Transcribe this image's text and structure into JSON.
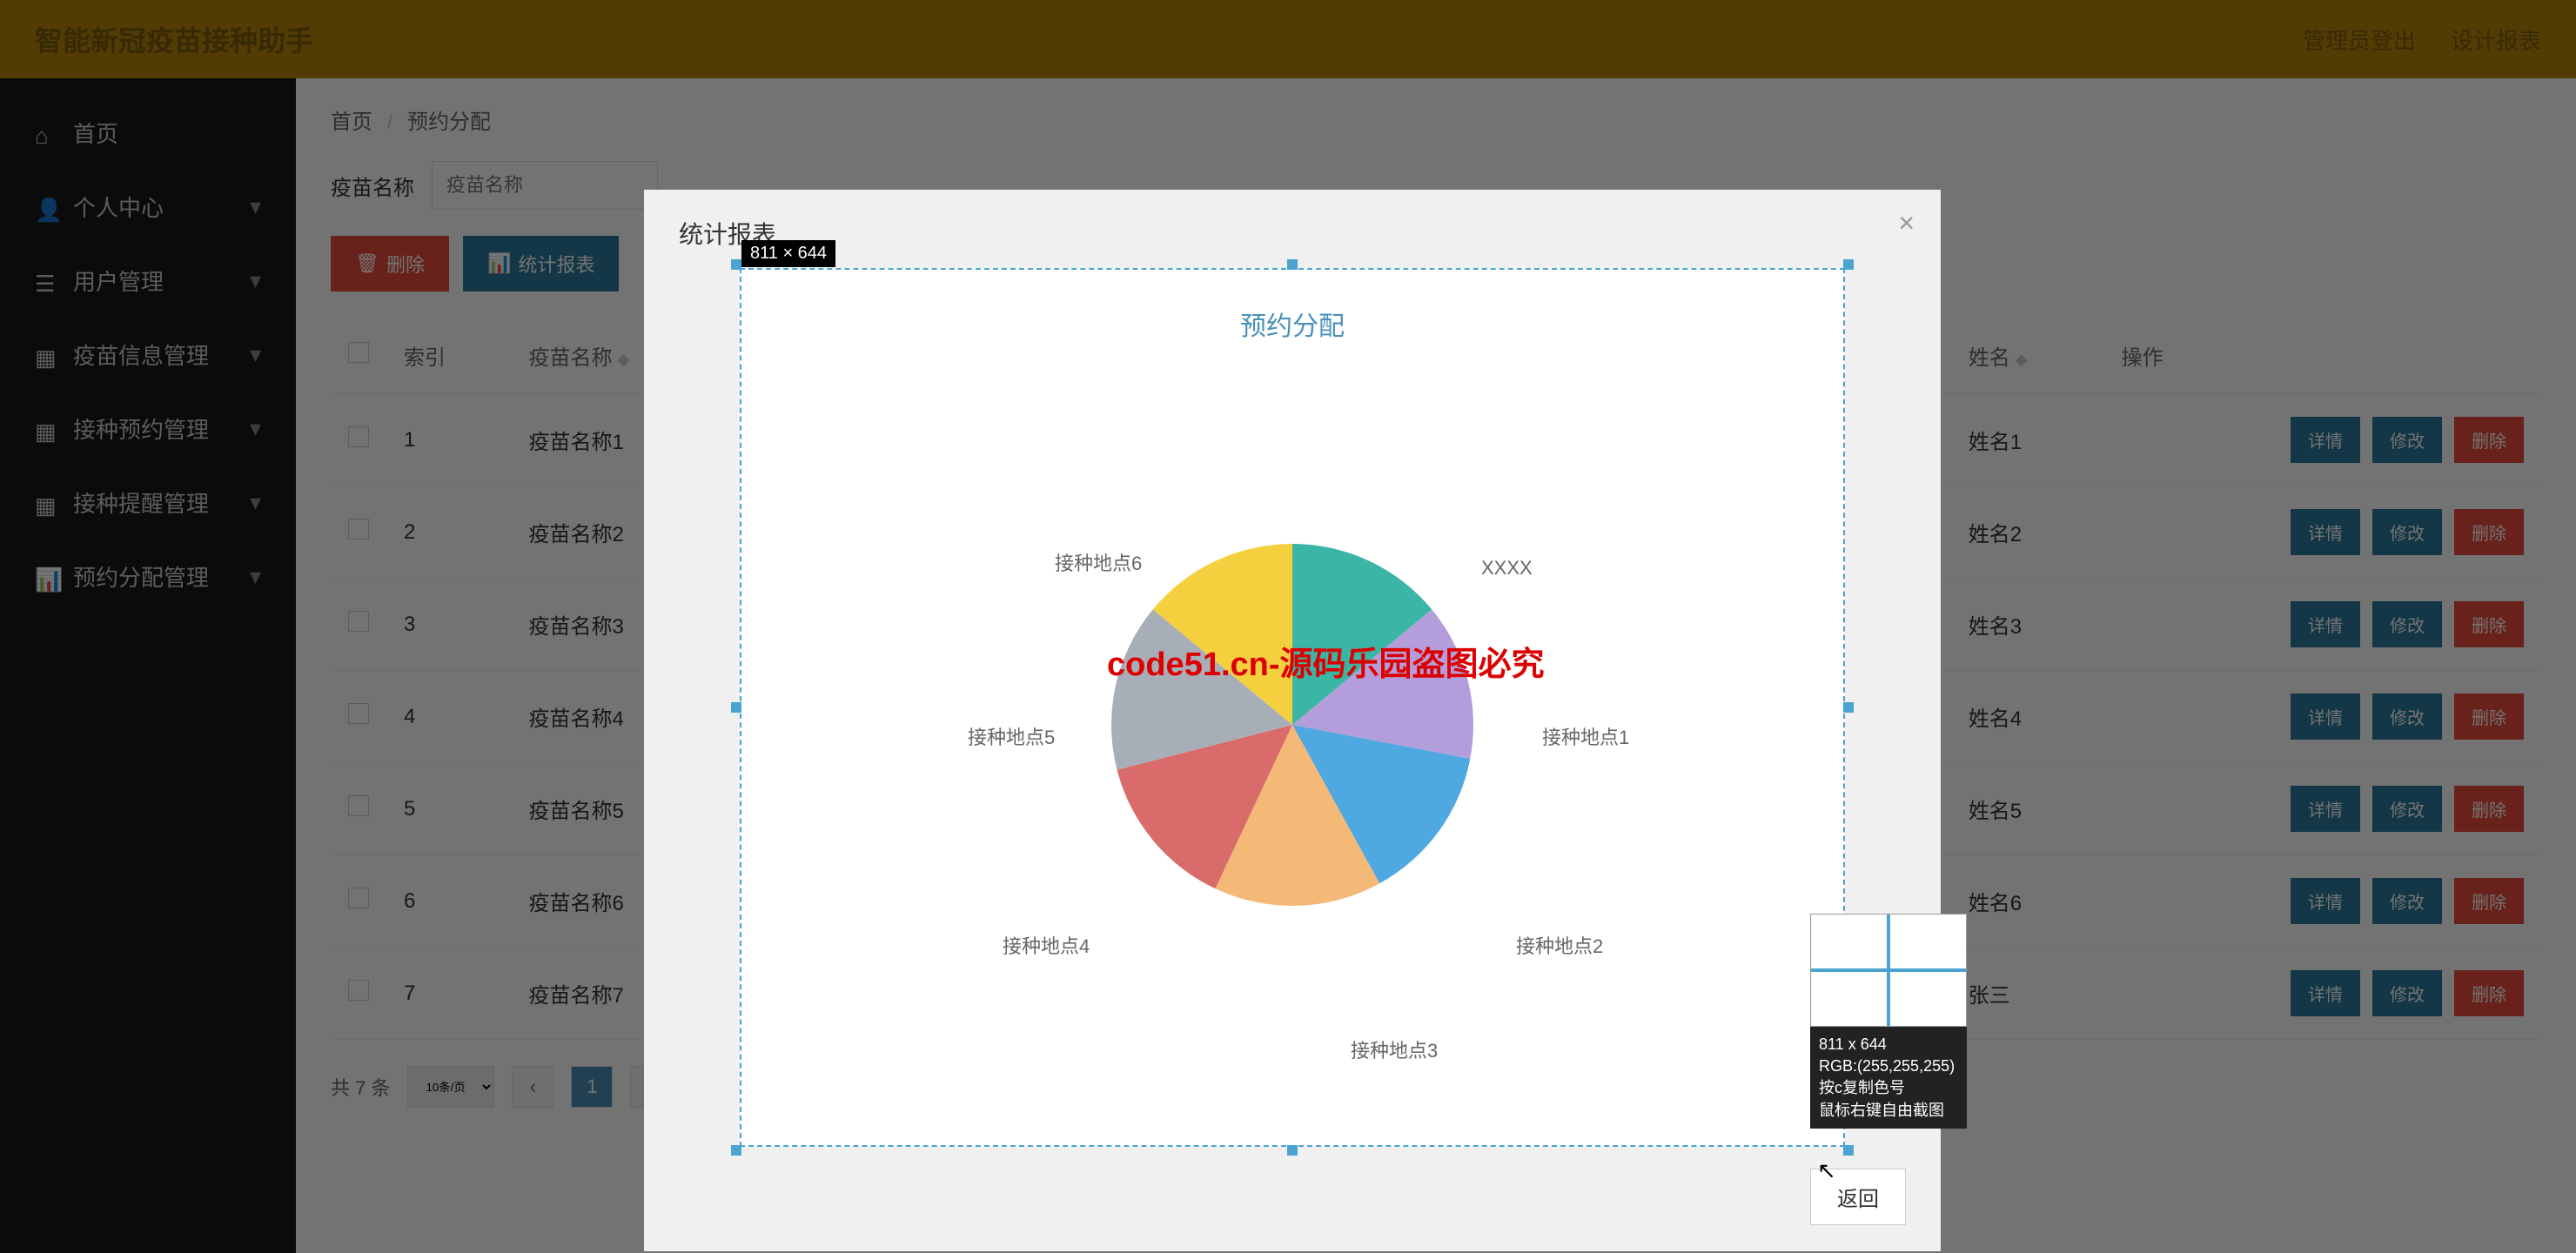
{
  "header": {
    "title": "智能新冠疫苗接种助手",
    "link1": "管理员登出",
    "link2": "设计报表"
  },
  "sidebar": {
    "items": [
      {
        "icon": "home",
        "label": "首页"
      },
      {
        "icon": "user",
        "label": "个人中心"
      },
      {
        "icon": "users",
        "label": "用户管理"
      },
      {
        "icon": "grid",
        "label": "疫苗信息管理"
      },
      {
        "icon": "grid",
        "label": "接种预约管理"
      },
      {
        "icon": "grid",
        "label": "接种提醒管理"
      },
      {
        "icon": "chart",
        "label": "预约分配管理"
      }
    ]
  },
  "breadcrumb": {
    "home": "首页",
    "current": "预约分配"
  },
  "search": {
    "label": "疫苗名称",
    "placeholder": "疫苗名称"
  },
  "toolbar": {
    "delete": "删除",
    "stats": "统计报表"
  },
  "table": {
    "headers": {
      "index": "索引",
      "vaccine": "疫苗名称",
      "name": "姓名",
      "ops": "操作"
    },
    "rows": [
      {
        "idx": "1",
        "vaccine": "疫苗名称1",
        "name": "姓名1"
      },
      {
        "idx": "2",
        "vaccine": "疫苗名称2",
        "name": "姓名2"
      },
      {
        "idx": "3",
        "vaccine": "疫苗名称3",
        "name": "姓名3"
      },
      {
        "idx": "4",
        "vaccine": "疫苗名称4",
        "name": "姓名4"
      },
      {
        "idx": "5",
        "vaccine": "疫苗名称5",
        "name": "姓名5"
      },
      {
        "idx": "6",
        "vaccine": "疫苗名称6",
        "name": "姓名6"
      },
      {
        "idx": "7",
        "vaccine": "疫苗名称7",
        "name": "张三"
      }
    ],
    "ops": {
      "detail": "详情",
      "edit": "修改",
      "delete": "删除"
    }
  },
  "pagination": {
    "total": "共 7 条",
    "perpage": "10条/页",
    "page1": "1"
  },
  "modal": {
    "title": "统计报表",
    "chart_title": "预约分配",
    "dim_badge": "811 × 644",
    "return_btn": "返回",
    "red_text": "code51.cn-源码乐园盗图必究"
  },
  "picker": {
    "dim": "811 x 644",
    "rgb": "RGB:(255,255,255)",
    "hint1": "按c复制色号",
    "hint2": "鼠标右键自由截图"
  },
  "chart_data": {
    "type": "pie",
    "title": "预约分配",
    "series": [
      {
        "name": "XXXX",
        "value": 14,
        "color": "#3bb6a6"
      },
      {
        "name": "接种地点1",
        "value": 14,
        "color": "#b39ddb"
      },
      {
        "name": "接种地点2",
        "value": 14,
        "color": "#4fa8e0"
      },
      {
        "name": "接种地点3",
        "value": 15,
        "color": "#f4b977"
      },
      {
        "name": "接种地点4",
        "value": 14,
        "color": "#d96b6b"
      },
      {
        "name": "接种地点5",
        "value": 15,
        "color": "#a8aeb8"
      },
      {
        "name": "接种地点6",
        "value": 14,
        "color": "#f4d03f"
      }
    ],
    "labels": [
      "XXXX",
      "接种地点1",
      "接种地点2",
      "接种地点3",
      "接种地点4",
      "接种地点5",
      "接种地点6"
    ]
  }
}
